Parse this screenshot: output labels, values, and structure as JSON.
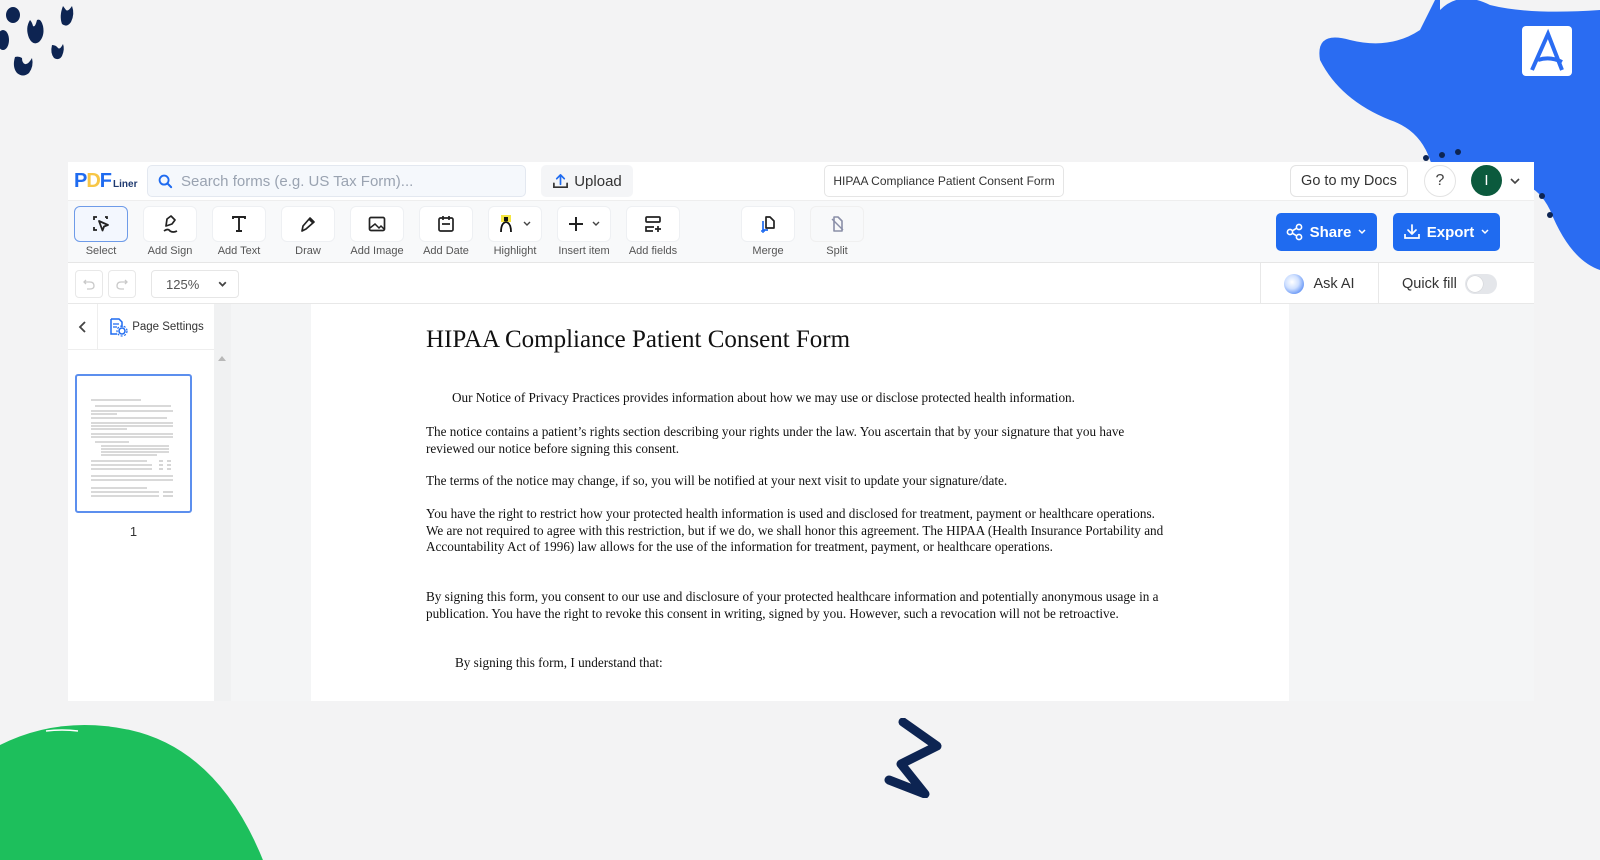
{
  "app": {
    "logo": {
      "p": "P",
      "d": "D",
      "f": "F",
      "suffix": "Liner"
    },
    "search": {
      "placeholder": "Search forms (e.g. US Tax Form)...",
      "value": ""
    },
    "upload_label": "Upload",
    "document_title": "HIPAA Compliance Patient Consent Form",
    "go_to_docs_label": "Go to my Docs",
    "help_label": "?",
    "avatar_initial": "I"
  },
  "toolbar": {
    "tools": [
      {
        "id": "select",
        "label": "Select",
        "active": true
      },
      {
        "id": "add-sign",
        "label": "Add Sign"
      },
      {
        "id": "add-text",
        "label": "Add Text"
      },
      {
        "id": "draw",
        "label": "Draw"
      },
      {
        "id": "add-image",
        "label": "Add Image"
      },
      {
        "id": "add-date",
        "label": "Add Date"
      },
      {
        "id": "highlight",
        "label": "Highlight"
      },
      {
        "id": "insert-item",
        "label": "Insert item"
      },
      {
        "id": "add-fields",
        "label": "Add fields"
      },
      {
        "id": "merge",
        "label": "Merge"
      },
      {
        "id": "split",
        "label": "Split"
      }
    ],
    "share_label": "Share",
    "export_label": "Export",
    "accent_color": "#1f6bf0",
    "highlight_color": "#f5e642"
  },
  "subbar": {
    "zoom_value": "125%",
    "ask_ai_label": "Ask AI",
    "quick_fill_label": "Quick fill",
    "quick_fill_enabled": false
  },
  "sidebar": {
    "page_settings_label": "Page Settings",
    "pages": [
      {
        "number": "1",
        "selected": true
      }
    ]
  },
  "document": {
    "title": "HIPAA Compliance Patient Consent Form",
    "paragraphs": [
      "Our Notice of Privacy Practices provides information about how we may use or disclose protected health information.",
      "The notice contains a patient’s rights section describing your rights under the law. You ascertain that by your signature that you have reviewed our notice before signing this consent.",
      "The terms of the notice may change, if so, you will be notified at your next visit to update your signature/date.",
      "You have the right to restrict how your protected health information is used and disclosed for treatment, payment or healthcare operations. We are not required to agree with this restriction, but if we do, we shall honor this agreement. The HIPAA (Health Insurance Portability and Accountability Act of 1996) law allows for the use of the information for treatment, payment, or healthcare operations.",
      "By signing this form, you consent to our use and disclosure of your protected healthcare information and potentially anonymous usage in a publication. You have the right to revoke this consent in writing, signed by you. However, such a revocation will not be retroactive.",
      "By signing this form, I understand that:"
    ]
  }
}
